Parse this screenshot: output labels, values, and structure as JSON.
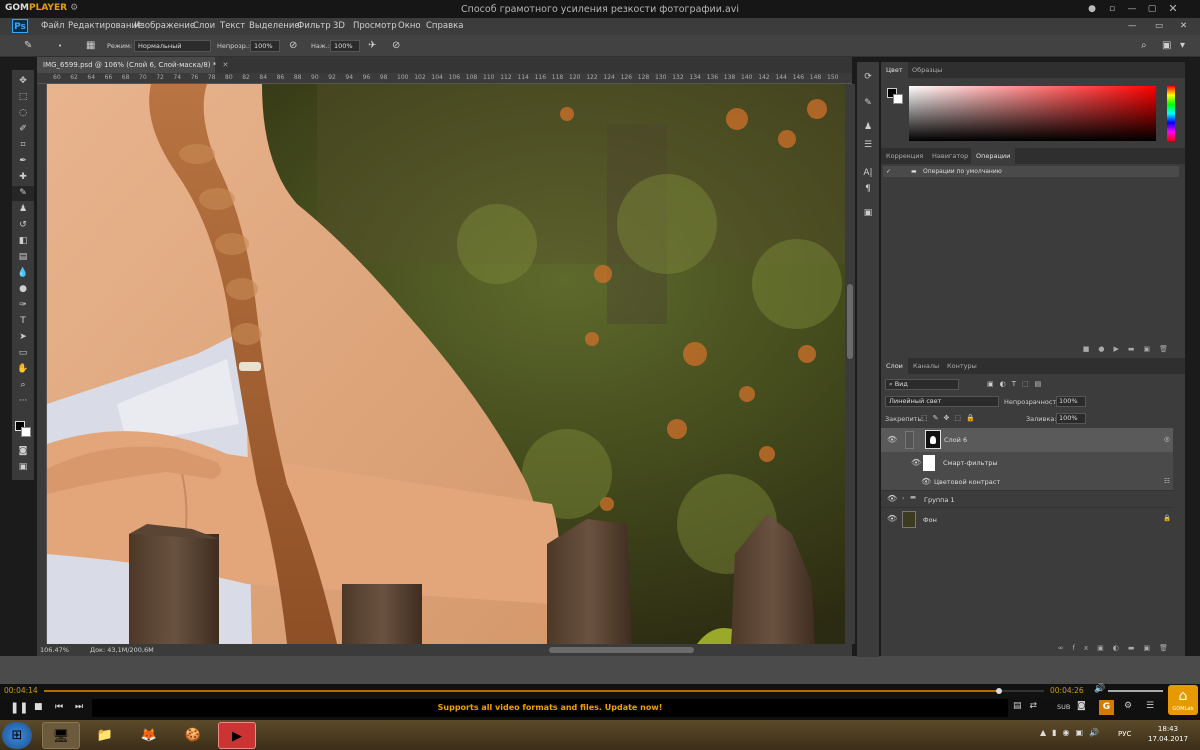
{
  "player": {
    "logo_main": "GOM",
    "logo_sub": "PLAYER",
    "file_title": "Способ грамотного усиления резкости фотографии.avi",
    "time_current": "00:04:14",
    "time_total": "00:04:26",
    "progress": 0.955,
    "ad_text": "Supports all video formats and files. Update now!",
    "logo_tag": "GOMLab"
  },
  "ps": {
    "logo": "Ps",
    "menu": [
      "Файл",
      "Редактирование",
      "Изображение",
      "Слои",
      "Текст",
      "Выделение",
      "Фильтр",
      "3D",
      "Просмотр",
      "Окно",
      "Справка"
    ],
    "options": {
      "mode_label": "Режим:",
      "mode_value": "Нормальный",
      "opacity_label": "Непрозр.:",
      "opacity_value": "100%",
      "flow_label": "Наж.:",
      "flow_value": "100%"
    },
    "doc_tab": "IMG_6599.psd @ 106% (Слой 6, Слой-маска/8) *",
    "ruler_marks": [
      "60",
      "62",
      "64",
      "66",
      "68",
      "70",
      "72",
      "74",
      "76",
      "78",
      "80",
      "82",
      "84",
      "86",
      "88",
      "90",
      "92",
      "94",
      "96",
      "98",
      "100",
      "102",
      "104",
      "106",
      "108",
      "110",
      "112",
      "114",
      "116",
      "118",
      "120",
      "122",
      "124",
      "126",
      "128",
      "130",
      "132",
      "134",
      "136",
      "138",
      "140",
      "142",
      "144",
      "146",
      "148",
      "150"
    ],
    "status_zoom": "106.47%",
    "status_doc": "Док: 43,1M/200,6M",
    "color_panel": {
      "tabs": [
        "Цвет",
        "Образцы"
      ]
    },
    "actions_panel": {
      "tabs": [
        "Коррекция",
        "Навигатор",
        "Операции"
      ],
      "default_set": "Операции по умолчанию"
    },
    "layers_panel": {
      "tabs": [
        "Слои",
        "Каналы",
        "Контуры"
      ],
      "filter_kind": "Вид",
      "blend_mode": "Линейный свет",
      "opacity_label": "Непрозрачность:",
      "opacity_value": "100%",
      "lock_label": "Закрепить:",
      "fill_label": "Заливка:",
      "fill_value": "100%",
      "layers": [
        {
          "name": "Слой 6"
        },
        {
          "name": "Смарт-фильтры"
        },
        {
          "name": "Цветовой контраст"
        },
        {
          "name": "Группа 1"
        },
        {
          "name": "Фон"
        }
      ]
    }
  },
  "taskbar": {
    "lang": "РУС",
    "time": "18:43",
    "date": "17.04.2017"
  }
}
